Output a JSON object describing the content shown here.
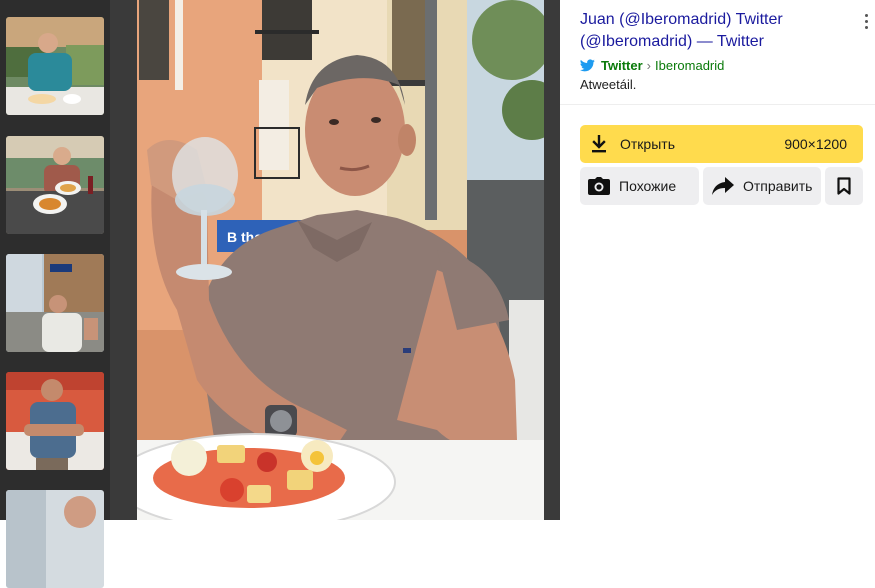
{
  "panel": {
    "title": "Juan (@Iberomadrid) Twitter (@Iberomadrid) — Twitter",
    "source": {
      "icon": "twitter-bird-icon",
      "name": "Twitter",
      "separator": "›",
      "path": "Iberomadrid"
    },
    "snippet": "Atweetáil.",
    "open_button": {
      "label": "Открыть",
      "size": "900×1200",
      "icon": "download-icon"
    },
    "similar_button": {
      "label": "Похожие",
      "icon": "camera-icon"
    },
    "share_button": {
      "label": "Отправить",
      "icon": "share-arrow-icon"
    },
    "bookmark_button": {
      "icon": "bookmark-icon"
    },
    "more_menu": {
      "icon": "more-vertical-icon"
    }
  },
  "thumbnails": [
    {
      "name": "thumb-1",
      "active": true
    },
    {
      "name": "thumb-2",
      "active": false
    },
    {
      "name": "thumb-3",
      "active": false
    },
    {
      "name": "thumb-4",
      "active": false
    },
    {
      "name": "thumb-5",
      "active": false
    }
  ],
  "main_image": {
    "description_icon": "photo-man-with-wine-glass",
    "storefront_sign": "B the tra"
  },
  "colors": {
    "open_button": "#ffdb4d",
    "title_link": "#1a1a9e",
    "source_link": "#0a7a0a",
    "twitter_blue": "#1d9bf0",
    "viewer_bg": "#2d2d2d"
  }
}
